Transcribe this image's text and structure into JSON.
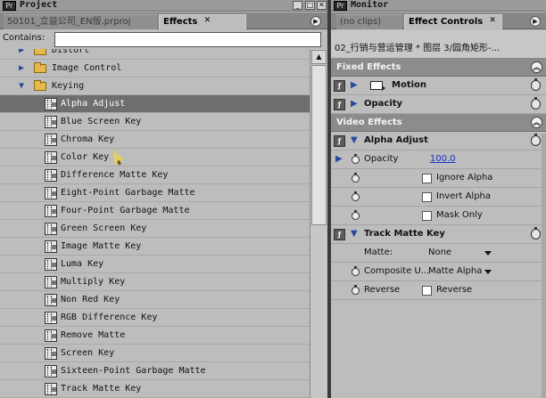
{
  "left_panel": {
    "window_title": "Project",
    "tabs": [
      {
        "label": "50101_立益公司_EN版.prproj",
        "active": false
      },
      {
        "label": "Effects",
        "active": true
      }
    ],
    "contains_label": "Contains:",
    "contains_value": "",
    "tree": [
      {
        "label": "Distort",
        "type": "folder",
        "expanded": false,
        "partial": true
      },
      {
        "label": "Image Control",
        "type": "folder",
        "expanded": false
      },
      {
        "label": "Keying",
        "type": "folder",
        "expanded": true
      },
      {
        "label": "Alpha Adjust",
        "type": "effect",
        "selected": true
      },
      {
        "label": "Blue Screen Key",
        "type": "effect"
      },
      {
        "label": "Chroma Key",
        "type": "effect"
      },
      {
        "label": "Color Key",
        "type": "effect"
      },
      {
        "label": "Difference Matte Key",
        "type": "effect"
      },
      {
        "label": "Eight-Point Garbage Matte",
        "type": "effect"
      },
      {
        "label": "Four-Point Garbage Matte",
        "type": "effect"
      },
      {
        "label": "Green Screen Key",
        "type": "effect"
      },
      {
        "label": "Image Matte Key",
        "type": "effect"
      },
      {
        "label": "Luma Key",
        "type": "effect"
      },
      {
        "label": "Multiply Key",
        "type": "effect"
      },
      {
        "label": "Non Red Key",
        "type": "effect"
      },
      {
        "label": "RGB Difference Key",
        "type": "effect"
      },
      {
        "label": "Remove Matte",
        "type": "effect"
      },
      {
        "label": "Screen Key",
        "type": "effect"
      },
      {
        "label": "Sixteen-Point Garbage Matte",
        "type": "effect"
      },
      {
        "label": "Track Matte Key",
        "type": "effect"
      }
    ]
  },
  "right_panel": {
    "window_title": "Monitor",
    "tabs": [
      {
        "label": "(no clips)",
        "active": false
      },
      {
        "label": "Effect Controls",
        "active": true
      }
    ],
    "clip_name": "02_行销与营运管理 * 图层 3/园角矩形-...",
    "fixed_effects_label": "Fixed Effects",
    "motion_label": "Motion",
    "opacity_label": "Opacity",
    "video_effects_label": "Video Effects",
    "alpha_adjust": {
      "name": "Alpha Adjust",
      "opacity_label": "Opacity",
      "opacity_value": "100.0",
      "ignore_alpha_label": "Ignore Alpha",
      "invert_alpha_label": "Invert Alpha",
      "mask_only_label": "Mask Only"
    },
    "track_matte_key": {
      "name": "Track Matte Key",
      "matte_label": "Matte:",
      "matte_value": "None",
      "composite_label": "Composite U...",
      "composite_value": "Matte Alpha",
      "reverse_label": "Reverse",
      "reverse_checkbox_label": "Reverse"
    }
  }
}
